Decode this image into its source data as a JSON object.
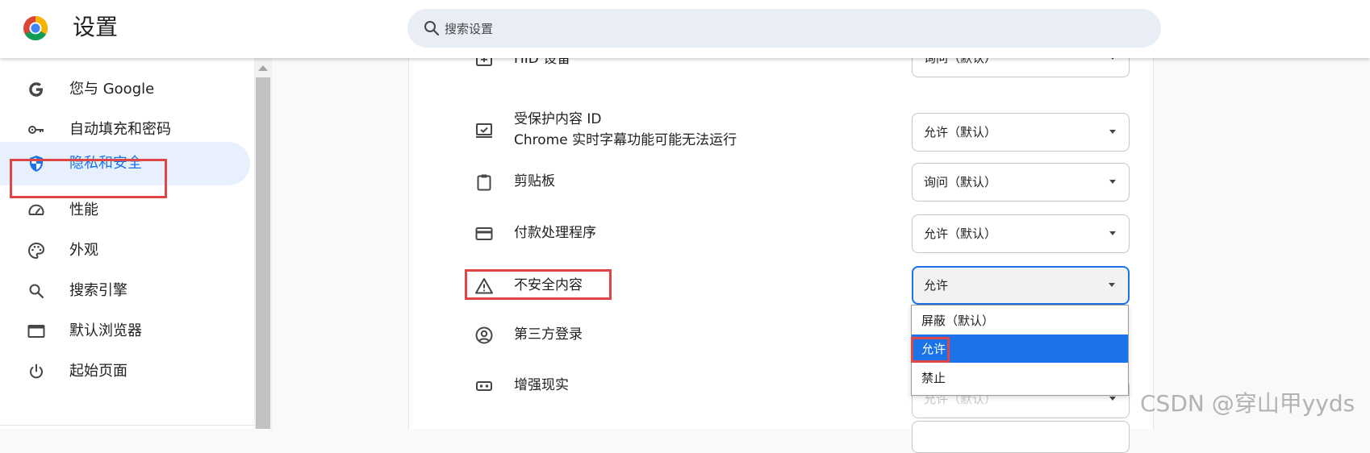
{
  "header": {
    "title": "设置",
    "search_placeholder": "搜索设置"
  },
  "sidebar": {
    "items": [
      {
        "label": "您与 Google",
        "icon": "google-g-icon"
      },
      {
        "label": "自动填充和密码",
        "icon": "key-icon"
      },
      {
        "label": "隐私和安全",
        "icon": "shield-icon",
        "active": true
      },
      {
        "label": "性能",
        "icon": "speedometer-icon"
      },
      {
        "label": "外观",
        "icon": "palette-icon"
      },
      {
        "label": "搜索引擎",
        "icon": "search-icon"
      },
      {
        "label": "默认浏览器",
        "icon": "browser-window-icon"
      },
      {
        "label": "起始页面",
        "icon": "power-icon"
      }
    ]
  },
  "permissions": {
    "rows": [
      {
        "title": "HID 设备",
        "icon": "hid-device-icon",
        "value": "询问（默认）"
      },
      {
        "title": "受保护内容 ID",
        "subtitle": "Chrome 实时字幕功能可能无法运行",
        "icon": "protected-content-icon",
        "value": "允许（默认）"
      },
      {
        "title": "剪贴板",
        "icon": "clipboard-icon",
        "value": "询问（默认）"
      },
      {
        "title": "付款处理程序",
        "icon": "credit-card-icon",
        "value": "允许（默认）"
      },
      {
        "title": "不安全内容",
        "icon": "warning-triangle-icon",
        "value": "允许"
      },
      {
        "title": "第三方登录",
        "icon": "account-circle-icon",
        "value": ""
      },
      {
        "title": "增强现实",
        "icon": "vr-headset-icon",
        "value": "允许（默认）"
      }
    ]
  },
  "dropdown_menu": {
    "options": [
      "屏蔽（默认）",
      "允许",
      "禁止"
    ],
    "selected": "允许"
  },
  "watermark": "CSDN @穿山甲yyds",
  "colors": {
    "accent": "#1a73e8",
    "highlight_box": "#e04646",
    "active_nav_bg": "#e8f0fe"
  }
}
